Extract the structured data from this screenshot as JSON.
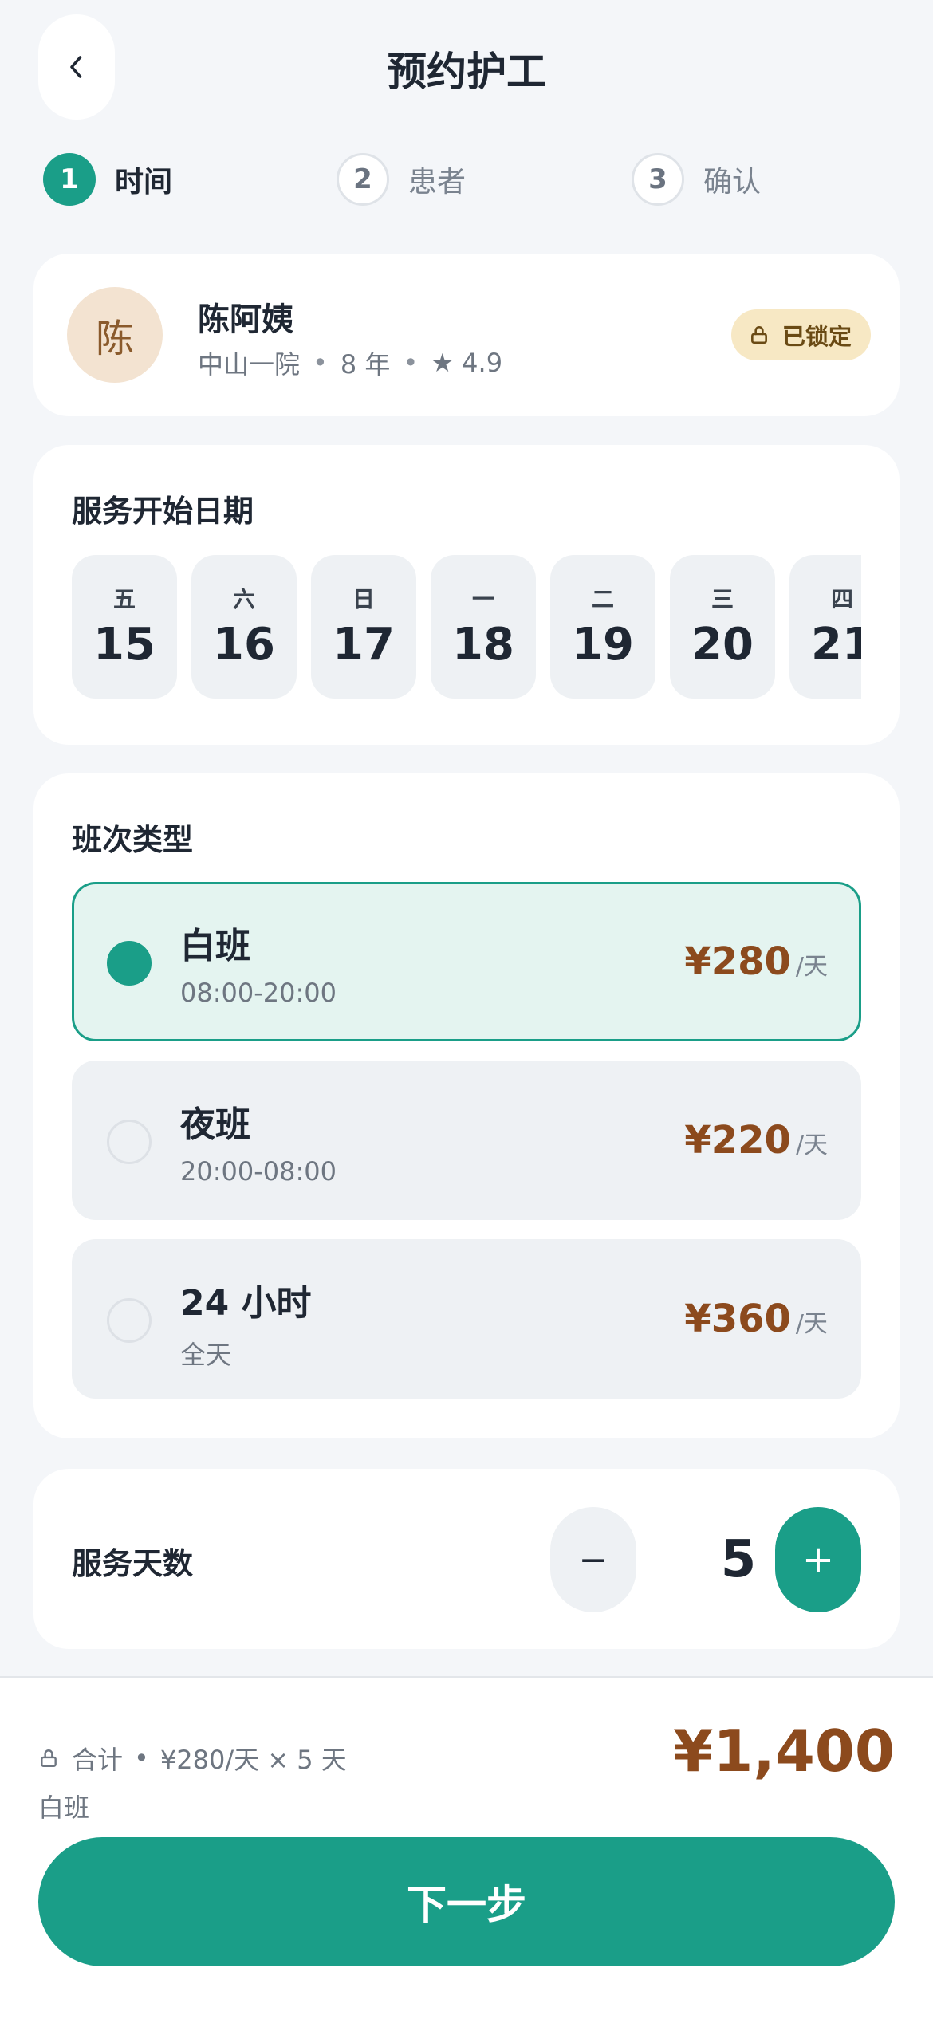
{
  "header": {
    "title": "预约护工",
    "back_icon": "chevron-left-icon"
  },
  "steps": [
    {
      "number": "1",
      "label": "时间",
      "state": "active"
    },
    {
      "number": "2",
      "label": "患者",
      "state": "inactive"
    },
    {
      "number": "3",
      "label": "确认",
      "state": "inactive"
    }
  ],
  "caregiver": {
    "avatar_char": "陈",
    "name": "陈阿姨",
    "hospital": "中山一院",
    "experience": "8 年",
    "rating": "★ 4.9",
    "badge": "已锁定"
  },
  "date_section": {
    "title": "服务开始日期",
    "dates": [
      {
        "dow": "五",
        "day": "15"
      },
      {
        "dow": "六",
        "day": "16"
      },
      {
        "dow": "日",
        "day": "17"
      },
      {
        "dow": "一",
        "day": "18"
      },
      {
        "dow": "二",
        "day": "19"
      },
      {
        "dow": "三",
        "day": "20"
      },
      {
        "dow": "四",
        "day": "21"
      }
    ]
  },
  "shift_section": {
    "title": "班次类型",
    "options": [
      {
        "name": "白班",
        "time": "08:00-20:00",
        "price": "¥280",
        "unit": "/天",
        "selected": true
      },
      {
        "name": "夜班",
        "time": "20:00-08:00",
        "price": "¥220",
        "unit": "/天",
        "selected": false
      },
      {
        "name": "24 小时",
        "time": "全天",
        "price": "¥360",
        "unit": "/天",
        "selected": false
      }
    ]
  },
  "days_section": {
    "title": "服务天数",
    "minus": "−",
    "value": "5",
    "plus": "+"
  },
  "footer": {
    "total_label": "合计",
    "total_formula": "¥280/天 × 5 天",
    "shift_name": "白班",
    "total_amount": "¥1,400",
    "next_label": "下一步"
  },
  "colors": {
    "primary": "#1a9e88",
    "price": "#8c4a1d",
    "badge_bg": "#f7e8c4"
  }
}
